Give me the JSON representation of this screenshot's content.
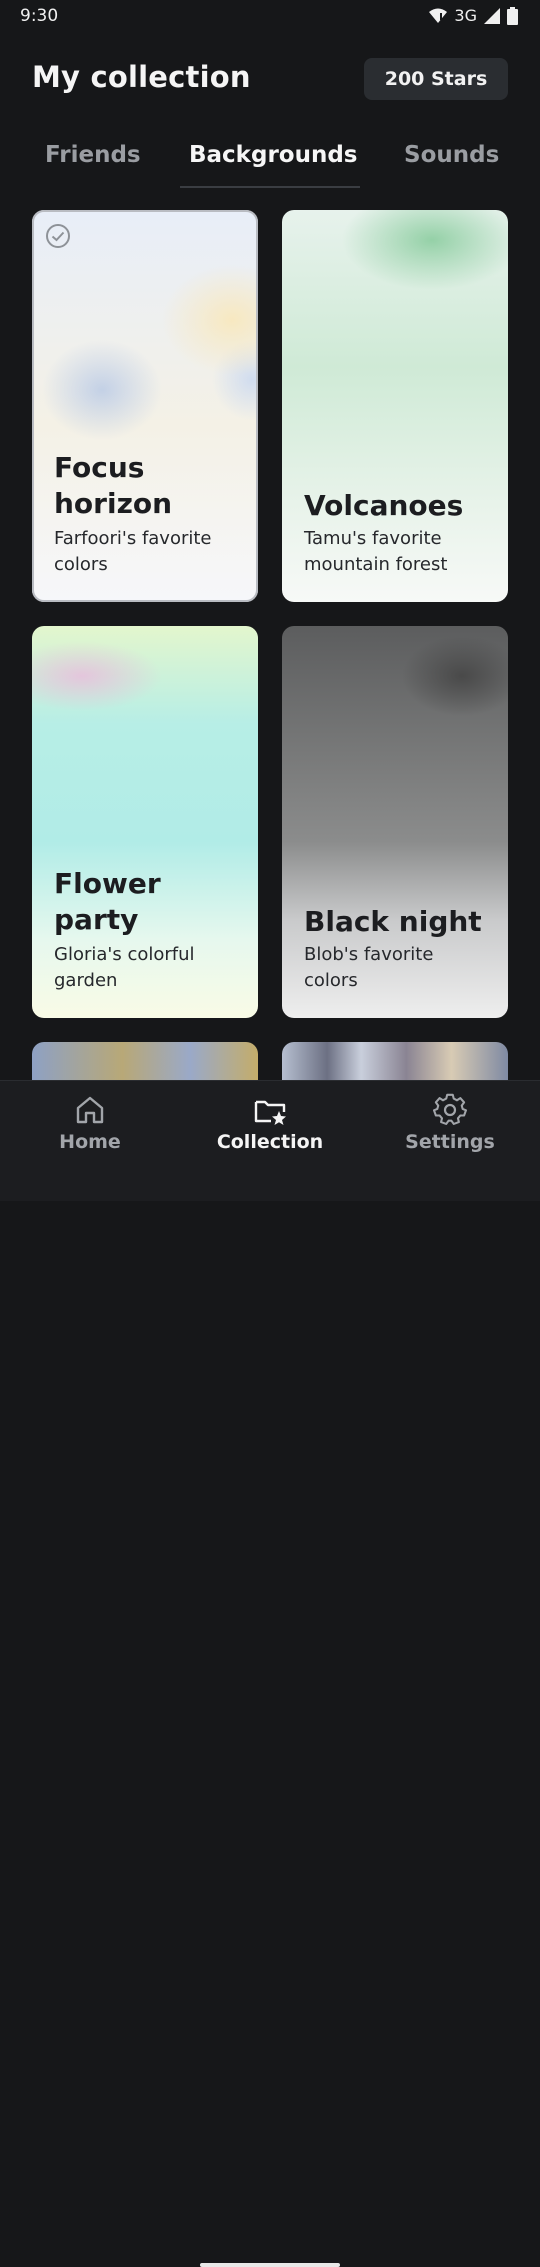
{
  "status_bar": {
    "time": "9:30",
    "network": "3G"
  },
  "header": {
    "title": "My collection",
    "stars_label": "200 Stars"
  },
  "tabs": [
    {
      "label": "Friends"
    },
    {
      "label": "Backgrounds"
    },
    {
      "label": "Sounds"
    }
  ],
  "active_tab": "Backgrounds",
  "cards": [
    {
      "title": "Focus horizon",
      "description": "Farfoori's favorite colors",
      "selected": true
    },
    {
      "title": "Volcanoes",
      "description": "Tamu's favorite mountain forest"
    },
    {
      "title": "Flower party",
      "description": "Gloria's colorful garden"
    },
    {
      "title": "Black night",
      "description": "Blob's favorite colors"
    }
  ],
  "bottom_nav": [
    {
      "label": "Home",
      "icon": "home-icon"
    },
    {
      "label": "Collection",
      "icon": "folder-star-icon"
    },
    {
      "label": "Settings",
      "icon": "gear-icon"
    }
  ],
  "active_nav": "Collection"
}
